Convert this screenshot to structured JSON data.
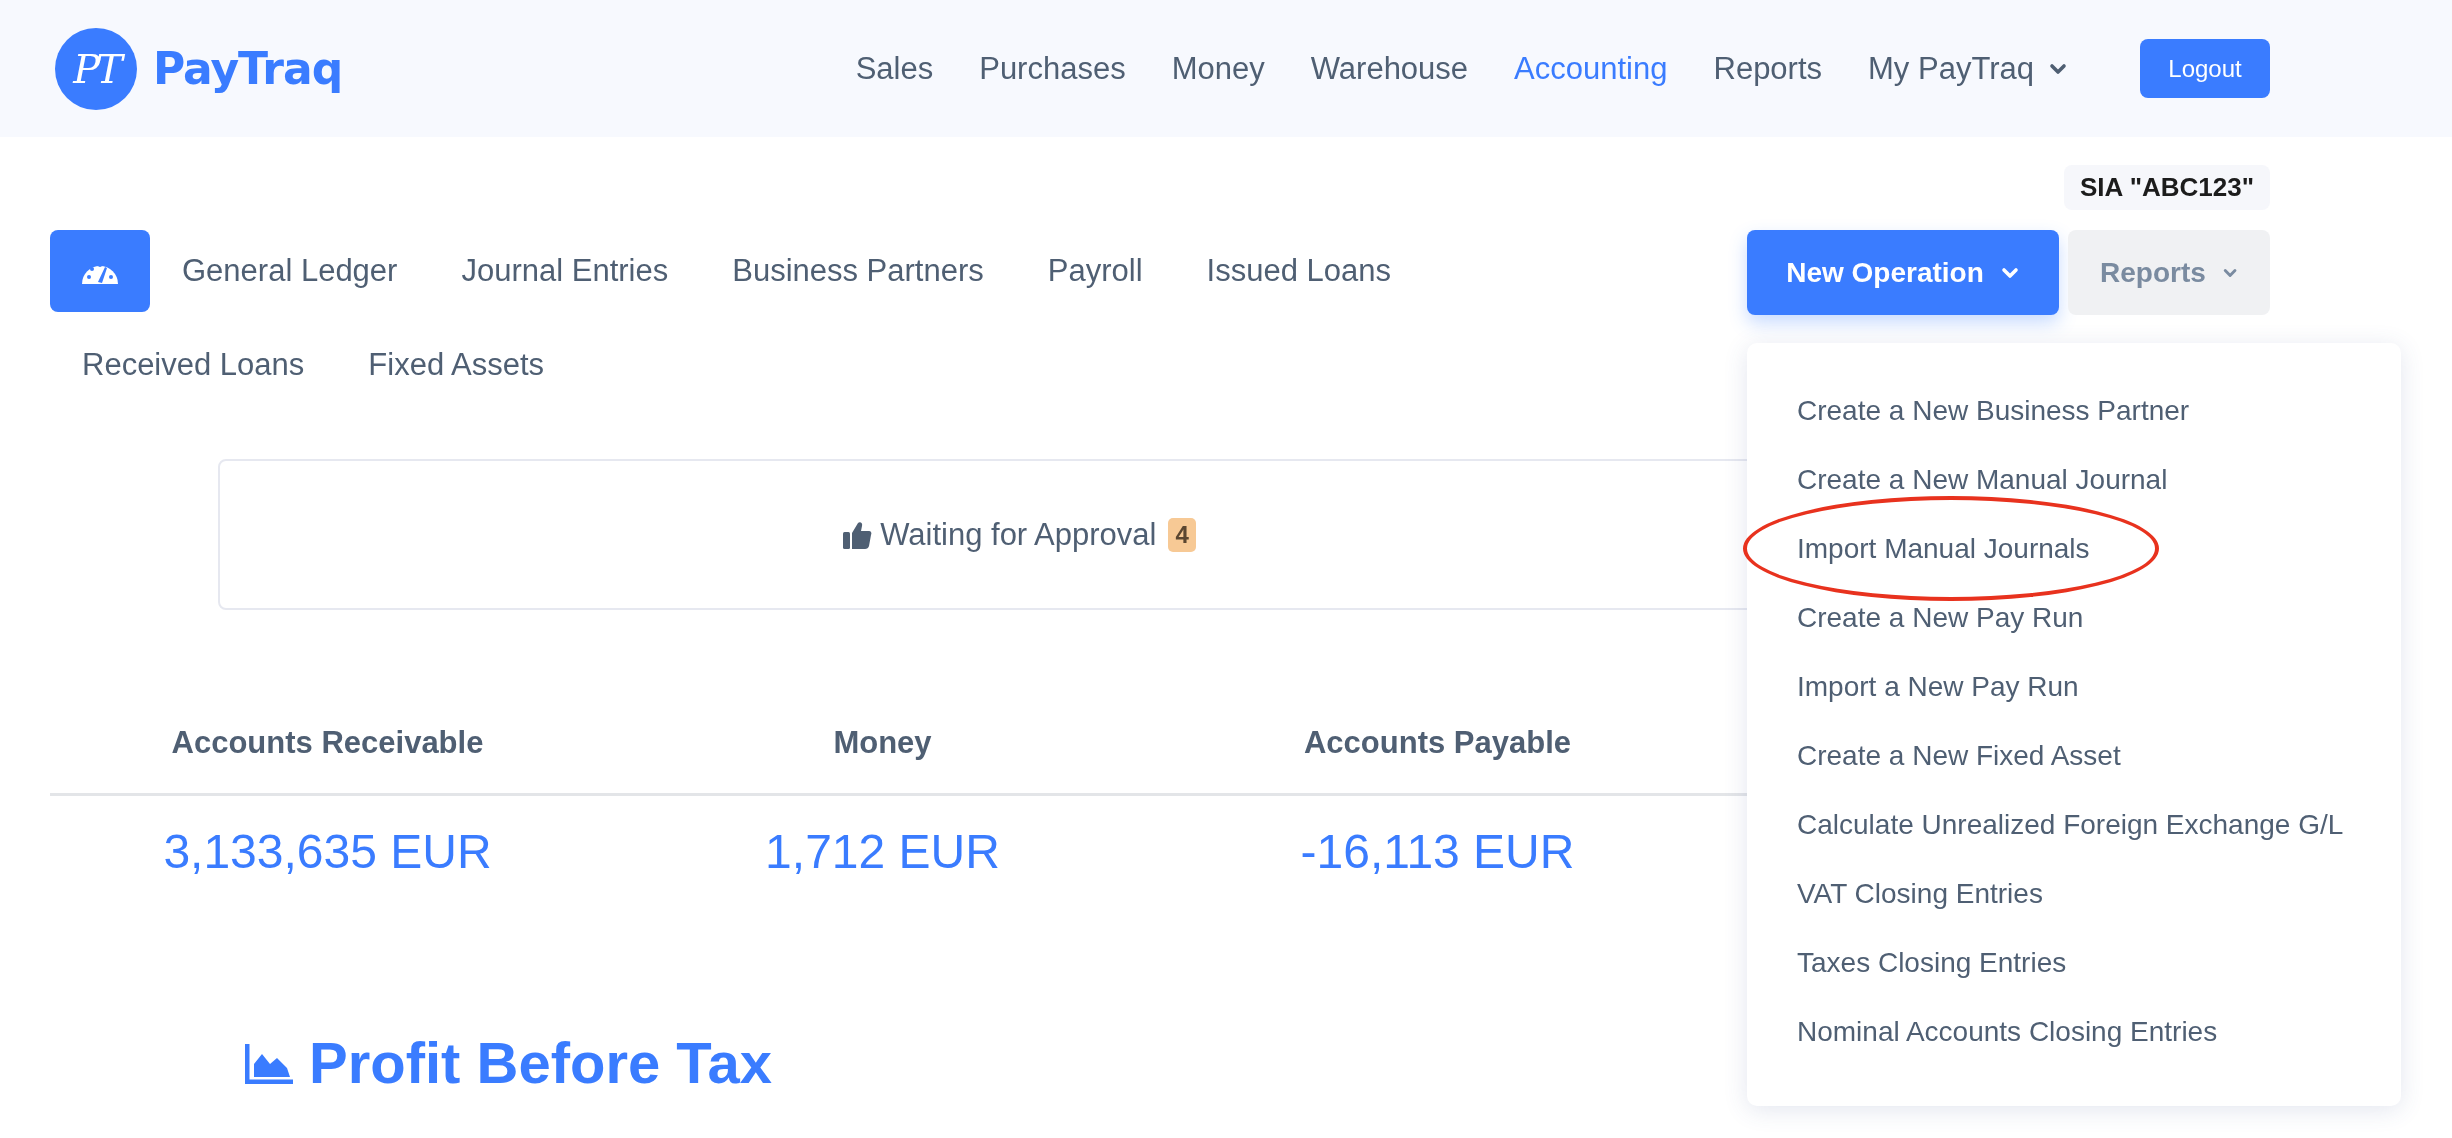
{
  "header": {
    "logo_mark": "PT",
    "logo_text": "PayTraq",
    "nav": [
      {
        "label": "Sales",
        "selected": false,
        "has_menu": false
      },
      {
        "label": "Purchases",
        "selected": false,
        "has_menu": false
      },
      {
        "label": "Money",
        "selected": false,
        "has_menu": false
      },
      {
        "label": "Warehouse",
        "selected": false,
        "has_menu": false
      },
      {
        "label": "Accounting",
        "selected": true,
        "has_menu": false
      },
      {
        "label": "Reports",
        "selected": false,
        "has_menu": false
      },
      {
        "label": "My PayTraq",
        "selected": false,
        "has_menu": true
      }
    ],
    "logout": "Logout"
  },
  "company": "SIA \"ABC123\"",
  "tabs": [
    {
      "kind": "dashboard",
      "selected": true
    },
    {
      "kind": "text",
      "label": "General Ledger",
      "selected": false
    },
    {
      "kind": "text",
      "label": "Journal Entries",
      "selected": false
    },
    {
      "kind": "text",
      "label": "Business Partners",
      "selected": false
    },
    {
      "kind": "text",
      "label": "Payroll",
      "selected": false
    },
    {
      "kind": "text",
      "label": "Issued Loans",
      "selected": false
    },
    {
      "kind": "text",
      "label": "Received Loans",
      "selected": false
    },
    {
      "kind": "text",
      "label": "Fixed Assets",
      "selected": false
    }
  ],
  "actions": [
    {
      "label": "New Operation",
      "kind": "primary",
      "expanded": true
    },
    {
      "label": "Reports",
      "kind": "secondary",
      "expanded": false
    }
  ],
  "menu": {
    "items": [
      {
        "label": "Create a New Business Partner",
        "circled": false
      },
      {
        "label": "Create a New Manual Journal",
        "circled": false
      },
      {
        "label": "Import Manual Journals",
        "circled": true
      },
      {
        "label": "Create a New Pay Run",
        "circled": false
      },
      {
        "label": "Import a New Pay Run",
        "circled": false
      },
      {
        "label": "Create a New Fixed Asset",
        "circled": false
      },
      {
        "label": "Calculate Unrealized Foreign Exchange G/L",
        "circled": false
      },
      {
        "label": "VAT Closing Entries",
        "circled": false
      },
      {
        "label": "Taxes Closing Entries",
        "circled": false
      },
      {
        "label": "Nominal Accounts Closing Entries",
        "circled": false
      }
    ]
  },
  "approval": {
    "label": "Waiting for Approval",
    "count": "4"
  },
  "stats": [
    {
      "title": "Accounts Receivable",
      "value": "3,133,635 EUR"
    },
    {
      "title": "Money",
      "value": "1,712 EUR"
    },
    {
      "title": "Accounts Payable",
      "value": "-16,113 EUR"
    }
  ],
  "profit": {
    "title": "Profit Before Tax"
  }
}
